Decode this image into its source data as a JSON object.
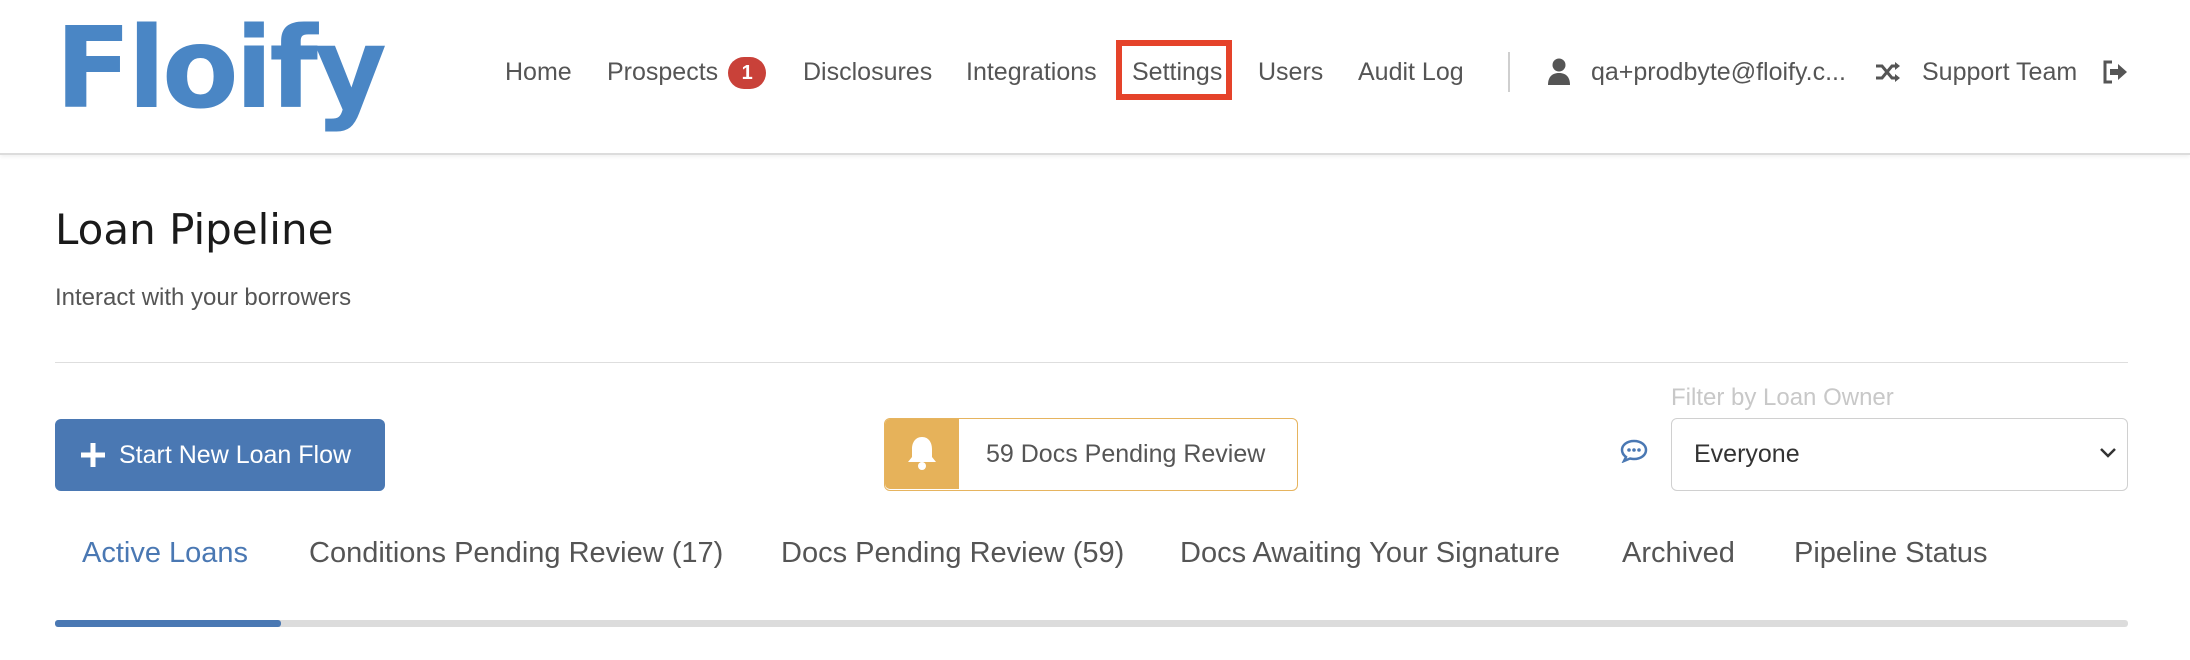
{
  "brand": {
    "logo_text": "Floify",
    "color": "#4a86c5"
  },
  "nav": {
    "home": "Home",
    "prospects": "Prospects",
    "prospects_badge": "1",
    "disclosures": "Disclosures",
    "integrations": "Integrations",
    "settings": "Settings",
    "users": "Users",
    "audit_log": "Audit Log",
    "user_email": "qa+prodbyte@floify.c...",
    "support_team": "Support Team",
    "icons": [
      "user-icon",
      "shuffle-icon",
      "sign-out-icon"
    ]
  },
  "page": {
    "title": "Loan Pipeline",
    "subtitle": "Interact with your borrowers"
  },
  "actions": {
    "start_button": "Start New Loan Flow",
    "docs_pending": "59 Docs Pending Review",
    "filter_label": "Filter by Loan Owner",
    "filter_value": "Everyone",
    "accent_color": "#4a78b3",
    "warning_color": "#e6b25a"
  },
  "tabs": [
    {
      "label": "Active Loans",
      "active": true
    },
    {
      "label": "Conditions Pending Review (17)",
      "active": false
    },
    {
      "label": "Docs Pending Review (59)",
      "active": false
    },
    {
      "label": "Docs Awaiting Your Signature",
      "active": false
    },
    {
      "label": "Archived",
      "active": false
    },
    {
      "label": "Pipeline Status",
      "active": false
    }
  ]
}
